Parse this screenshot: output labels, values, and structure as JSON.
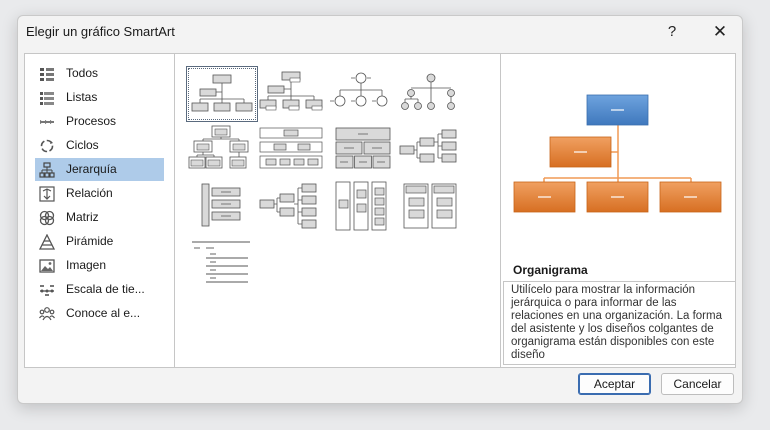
{
  "window": {
    "title": "Elegir un gráfico SmartArt",
    "help_label": "?",
    "close_label": "✕"
  },
  "categories": [
    {
      "label": "Todos",
      "icon": "all-icon",
      "selected": false
    },
    {
      "label": "Listas",
      "icon": "list-icon",
      "selected": false
    },
    {
      "label": "Procesos",
      "icon": "process-icon",
      "selected": false
    },
    {
      "label": "Ciclos",
      "icon": "cycle-icon",
      "selected": false
    },
    {
      "label": "Jerarquía",
      "icon": "hierarchy-icon",
      "selected": true
    },
    {
      "label": "Relación",
      "icon": "relationship-icon",
      "selected": false
    },
    {
      "label": "Matriz",
      "icon": "matrix-icon",
      "selected": false
    },
    {
      "label": "Pirámide",
      "icon": "pyramid-icon",
      "selected": false
    },
    {
      "label": "Imagen",
      "icon": "picture-icon",
      "selected": false
    },
    {
      "label": "Escala de tie...",
      "icon": "timeline-icon",
      "selected": false
    },
    {
      "label": "Conoce al e...",
      "icon": "team-icon",
      "selected": false
    }
  ],
  "gallery": [
    {
      "name": "organization-chart",
      "selected": true
    },
    {
      "name": "name-and-title-org-chart",
      "selected": false
    },
    {
      "name": "circle-picture-hierarchy",
      "selected": false
    },
    {
      "name": "circle-hierarchy",
      "selected": false
    },
    {
      "name": "hierarchy",
      "selected": false
    },
    {
      "name": "labeled-hierarchy",
      "selected": false
    },
    {
      "name": "table-hierarchy",
      "selected": false
    },
    {
      "name": "horizontal-hierarchy",
      "selected": false
    },
    {
      "name": "hierarchy-list",
      "selected": false
    },
    {
      "name": "horizontal-org-chart",
      "selected": false
    },
    {
      "name": "architecture-layout",
      "selected": false
    },
    {
      "name": "lined-list",
      "selected": false
    },
    {
      "name": "half-circle-org-chart",
      "selected": false
    }
  ],
  "preview": {
    "name": "Organigrama",
    "description": "Utilícelo para mostrar la información jerárquica o para informar de las relaciones en una organización. La forma del asistente y los diseños colgantes de organigrama están disponibles con este diseño",
    "colors": {
      "top": "#4a86c8",
      "assistant": "#e07a2c",
      "line": "#f09a55"
    }
  },
  "buttons": {
    "ok": "Aceptar",
    "cancel": "Cancelar"
  }
}
